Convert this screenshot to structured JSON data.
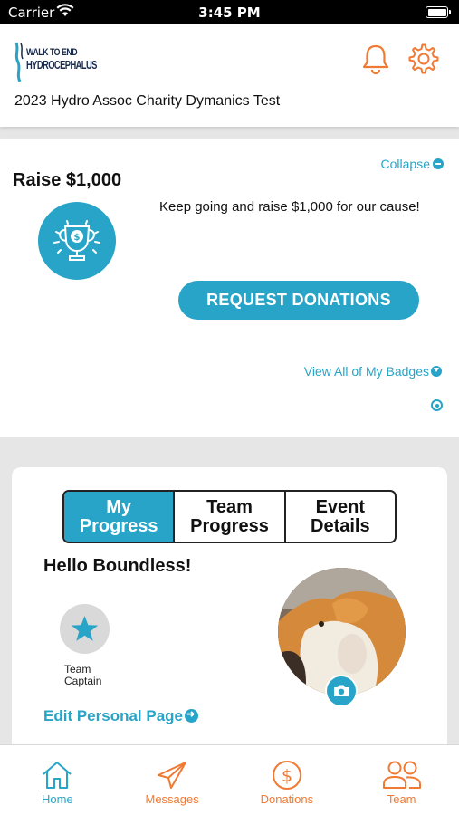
{
  "status_bar": {
    "carrier": "Carrier",
    "time": "3:45 PM"
  },
  "header": {
    "logo_line1": "WALK TO END",
    "logo_line2": "HYDROCEPHALUS",
    "event_title": "2023 Hydro Assoc Charity Dymanics Test",
    "icons": [
      "bell-icon",
      "gear-icon"
    ]
  },
  "badge_card": {
    "collapse_label": "Collapse",
    "title": "Raise $1,000",
    "description": "Keep going and raise $1,000 for our cause!",
    "request_button": "REQUEST DONATIONS",
    "view_badges": "View All of My Badges"
  },
  "progress_card": {
    "tabs": [
      {
        "label": "My\nProgress",
        "active": true
      },
      {
        "label": "Team\nProgress",
        "active": false
      },
      {
        "label": "Event\nDetails",
        "active": false
      }
    ],
    "greeting": "Hello Boundless!",
    "captain_label": "Team\nCaptain",
    "edit_link": "Edit Personal Page"
  },
  "tab_bar": {
    "items": [
      {
        "label": "Home",
        "icon": "home-icon",
        "active": true
      },
      {
        "label": "Messages",
        "icon": "paper-plane-icon",
        "active": false
      },
      {
        "label": "Donations",
        "icon": "dollar-circle-icon",
        "active": false
      },
      {
        "label": "Team",
        "icon": "team-icon",
        "active": false
      }
    ]
  },
  "colors": {
    "accent": "#27a4c7",
    "orange": "#f07a33"
  }
}
